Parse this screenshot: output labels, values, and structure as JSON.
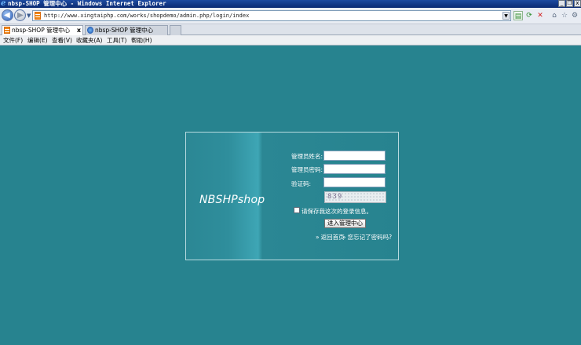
{
  "window": {
    "title": "nbsp-SHOP 管理中心 - Windows Internet Explorer",
    "buttons": [
      "_",
      "❐",
      "x"
    ]
  },
  "nav": {
    "url": "http://www.xingtaiphp.com/works/shopdemo/admin.php/login/index"
  },
  "tabs": [
    {
      "label": "nbsp-SHOP 管理中心",
      "close": "x"
    },
    {
      "label": "nbsp-SHOP 管理中心"
    }
  ],
  "menu": [
    "文件(F)",
    "编辑(E)",
    "查看(V)",
    "收藏夹(A)",
    "工具(T)",
    "帮助(H)"
  ],
  "login": {
    "brand": "NBSHPshop",
    "username_label": "管理员姓名:",
    "password_label": "管理员密码:",
    "captcha_label": "验证码:",
    "captcha_text": "839",
    "remember_label": "请保存我这次的登录信息。",
    "submit_label": "进入管理中心",
    "home_link": "返回首页",
    "forgot_link": "您忘记了密码吗?"
  }
}
